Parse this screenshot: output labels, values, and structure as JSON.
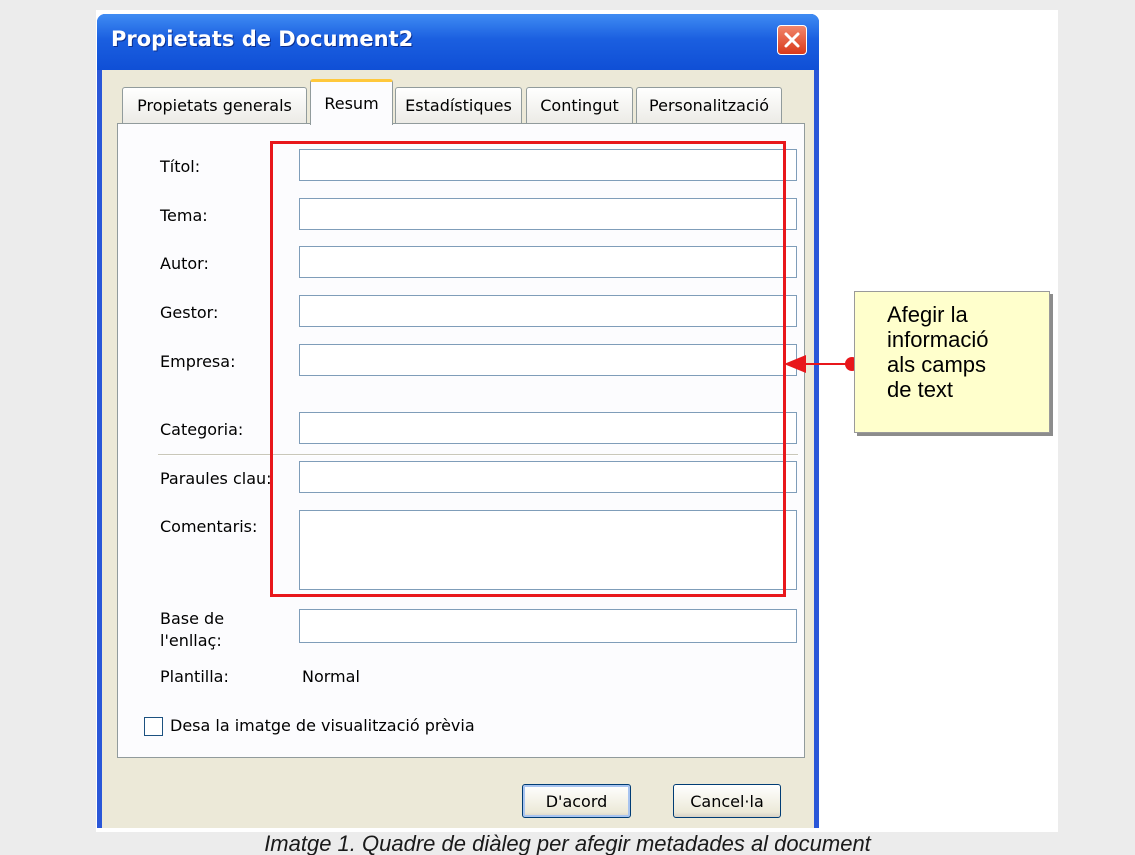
{
  "window": {
    "title": "Propietats de Document2"
  },
  "tabs": [
    {
      "label": "Propietats generals",
      "active": false
    },
    {
      "label": "Resum",
      "active": true
    },
    {
      "label": "Estadístiques",
      "active": false
    },
    {
      "label": "Contingut",
      "active": false
    },
    {
      "label": "Personalització",
      "active": false
    }
  ],
  "fields": {
    "titol": {
      "label": "Títol:",
      "value": ""
    },
    "tema": {
      "label": "Tema:",
      "value": ""
    },
    "autor": {
      "label": "Autor:",
      "value": ""
    },
    "gestor": {
      "label": "Gestor:",
      "value": ""
    },
    "empresa": {
      "label": "Empresa:",
      "value": ""
    },
    "categoria": {
      "label": "Categoria:",
      "value": ""
    },
    "paraules_clau": {
      "label": "Paraules clau:",
      "value": ""
    },
    "comentaris": {
      "label": "Comentaris:",
      "value": ""
    },
    "base_enllac": {
      "label_line1": "Base de",
      "label_line2": "l'enllaç:",
      "value": ""
    }
  },
  "template": {
    "label": "Plantilla:",
    "value": "Normal"
  },
  "checkbox": {
    "label": "Desa la imatge de visualització prèvia",
    "checked": false
  },
  "buttons": {
    "ok": "D'acord",
    "cancel": "Cancel·la"
  },
  "callout": {
    "text": "Afegir la\ninformació\nals camps\nde text"
  },
  "caption": "Imatge 1. Quadre de diàleg per afegir metadades al document",
  "colors": {
    "highlight": "#e8171b",
    "title_bar": "#0f4fd6",
    "callout_bg": "#ffffcc"
  }
}
